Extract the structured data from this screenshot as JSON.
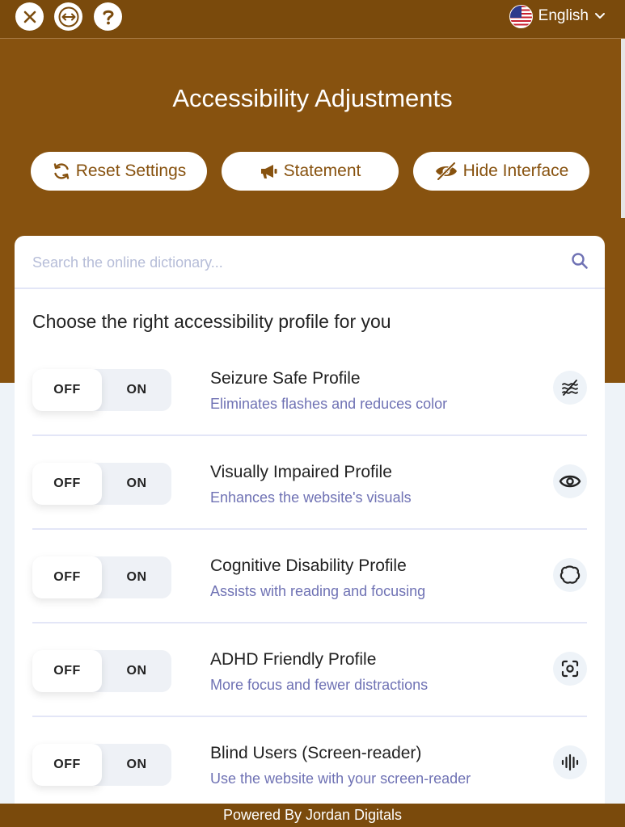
{
  "topbar": {
    "close_icon": "close-icon",
    "resize_icon": "resize-horizontal-icon",
    "help_icon": "help-icon",
    "language": "English"
  },
  "header": {
    "title": "Accessibility Adjustments",
    "actions": [
      {
        "label": "Reset Settings",
        "icon": "refresh-icon"
      },
      {
        "label": "Statement",
        "icon": "megaphone-icon"
      },
      {
        "label": "Hide Interface",
        "icon": "eye-slash-icon"
      }
    ]
  },
  "search": {
    "placeholder": "Search the online dictionary...",
    "value": ""
  },
  "profiles_heading": "Choose the right accessibility profile for you",
  "toggle_labels": {
    "off": "OFF",
    "on": "ON"
  },
  "profiles": [
    {
      "title": "Seizure Safe Profile",
      "desc": "Eliminates flashes and reduces color",
      "icon": "waves-icon",
      "state": "OFF"
    },
    {
      "title": "Visually Impaired Profile",
      "desc": "Enhances the website's visuals",
      "icon": "eye-icon",
      "state": "OFF"
    },
    {
      "title": "Cognitive Disability Profile",
      "desc": "Assists with reading and focusing",
      "icon": "brain-icon",
      "state": "OFF"
    },
    {
      "title": "ADHD Friendly Profile",
      "desc": "More focus and fewer distractions",
      "icon": "focus-icon",
      "state": "OFF"
    },
    {
      "title": "Blind Users (Screen-reader)",
      "desc": "Use the website with your screen-reader",
      "icon": "audio-wave-icon",
      "state": "OFF"
    }
  ],
  "footer": "Powered By Jordan Digitals",
  "colors": {
    "brand": "#87520f",
    "accent_text": "#6f72b4",
    "background": "#eef3f8"
  }
}
